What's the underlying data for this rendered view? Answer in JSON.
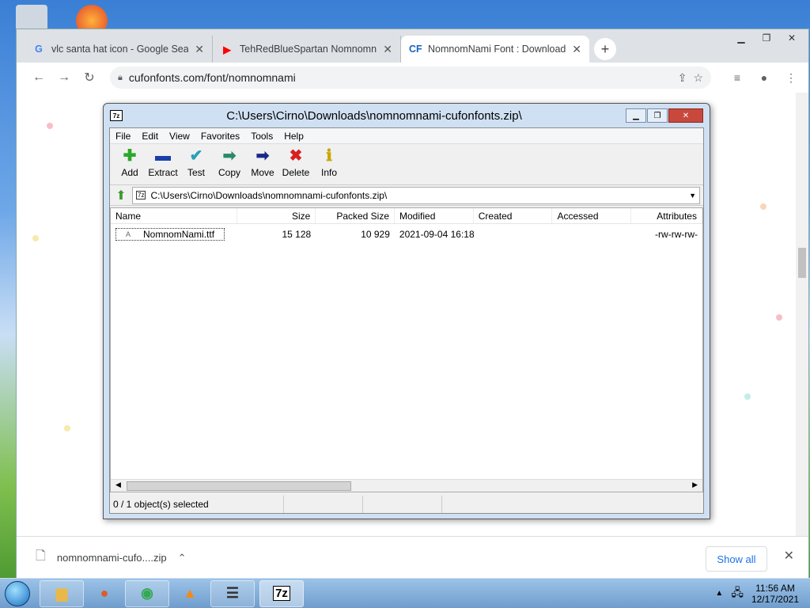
{
  "chrome": {
    "tabs": [
      {
        "icon": "google-icon",
        "title": "vlc santa hat icon - Google Search"
      },
      {
        "icon": "youtube-icon",
        "title": "TehRedBlueSpartan Nomnomnami"
      },
      {
        "icon": "cufonfonts-icon",
        "title": "NomnomNami Font : Download"
      }
    ],
    "url": "cufonfonts.com/font/nomnomnami"
  },
  "sevenzip": {
    "title": "C:\\Users\\Cirno\\Downloads\\nomnomnami-cufonfonts.zip\\",
    "menu": [
      "File",
      "Edit",
      "View",
      "Favorites",
      "Tools",
      "Help"
    ],
    "toolbar": [
      {
        "label": "Add",
        "glyph": "✚",
        "color": "#2aa82a"
      },
      {
        "label": "Extract",
        "glyph": "▬",
        "color": "#1a3fa8"
      },
      {
        "label": "Test",
        "glyph": "✔",
        "color": "#2a9fb8"
      },
      {
        "label": "Copy",
        "glyph": "➡",
        "color": "#2a8a6a"
      },
      {
        "label": "Move",
        "glyph": "➡",
        "color": "#1a2a8a"
      },
      {
        "label": "Delete",
        "glyph": "✖",
        "color": "#d82020"
      },
      {
        "label": "Info",
        "glyph": "ℹ",
        "color": "#c8a800"
      }
    ],
    "path": "C:\\Users\\Cirno\\Downloads\\nomnomnami-cufonfonts.zip\\",
    "columns": {
      "name": "Name",
      "size": "Size",
      "packed": "Packed Size",
      "modified": "Modified",
      "created": "Created",
      "accessed": "Accessed",
      "attributes": "Attributes"
    },
    "files": [
      {
        "name": "NomnomNami.ttf",
        "size": "15 128",
        "packed": "10 929",
        "modified": "2021-09-04 16:18",
        "created": "",
        "accessed": "",
        "attributes": "-rw-rw-rw-"
      }
    ],
    "status": "0 / 1 object(s) selected"
  },
  "download": {
    "file": "nomnomnami-cufo....zip",
    "show_all": "Show all"
  },
  "taskbar": {
    "time": "11:56 AM",
    "date": "12/17/2021"
  }
}
